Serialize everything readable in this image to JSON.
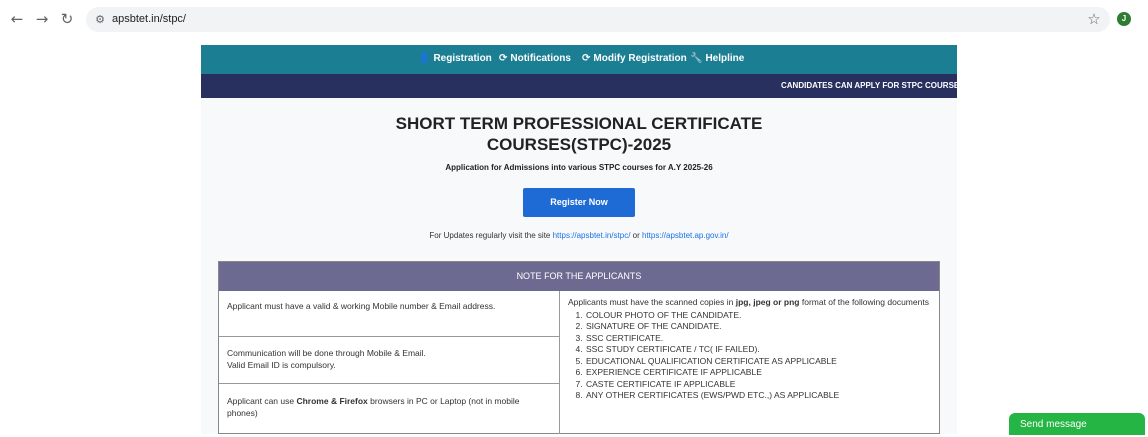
{
  "browser": {
    "url": "apsbtet.in/stpc/"
  },
  "nav": {
    "items": [
      {
        "icon": "user-icon",
        "glyph": "👤",
        "label": "Registration"
      },
      {
        "icon": "refresh-icon",
        "glyph": "⟳",
        "label": "Notifications"
      },
      {
        "icon": "refresh-icon",
        "glyph": "⟳",
        "label": "Modify Registration"
      },
      {
        "icon": "wrench-icon",
        "glyph": "🔧",
        "label": "Helpline"
      }
    ]
  },
  "ticker": {
    "text": "CANDIDATES CAN APPLY FOR STPC COURSES T"
  },
  "hero": {
    "title_line1": "SHORT TERM PROFESSIONAL CERTIFICATE",
    "title_line2": "COURSES(STPC)-2025",
    "subtitle": "Application for Admissions into various STPC courses for A.Y 2025-26",
    "register_label": "Register Now",
    "updates_prefix": "For Updates regularly visit the site ",
    "link1": "https://apsbtet.in/stpc/",
    "updates_or": " or ",
    "link2": "https://apsbtet.ap.gov.in/"
  },
  "note": {
    "heading": "NOTE FOR THE APPLICANTS",
    "left": {
      "cell1": "Applicant must have a valid & working Mobile number & Email address.",
      "cell2_line1": "Communication will be done through Mobile & Email.",
      "cell2_line2": "Valid Email ID is compulsory.",
      "cell3_prefix": "Applicant can use ",
      "cell3_bold": "Chrome & Firefox",
      "cell3_suffix": " browsers in PC or Laptop (not in mobile phones)"
    },
    "right": {
      "intro_prefix": "Applicants must have the scanned copies in ",
      "intro_bold": "jpg, jpeg or png",
      "intro_suffix": " format of the following documents",
      "docs": [
        "COLOUR PHOTO OF THE CANDIDATE.",
        "SIGNATURE OF THE CANDIDATE.",
        "SSC CERTIFICATE.",
        "SSC STUDY CERTIFICATE / TC( IF FAILED).",
        "EDUCATIONAL QUALIFICATION CERTIFICATE AS APPLICABLE",
        "EXPERIENCE CERTIFICATE IF APPLICABLE",
        "CASTE CERTIFICATE IF APPLICABLE",
        "ANY OTHER CERTIFICATES (EWS/PWD ETC.,) AS APPLICABLE"
      ]
    }
  },
  "chat": {
    "label": "Send message"
  },
  "avatar_letter": "J"
}
